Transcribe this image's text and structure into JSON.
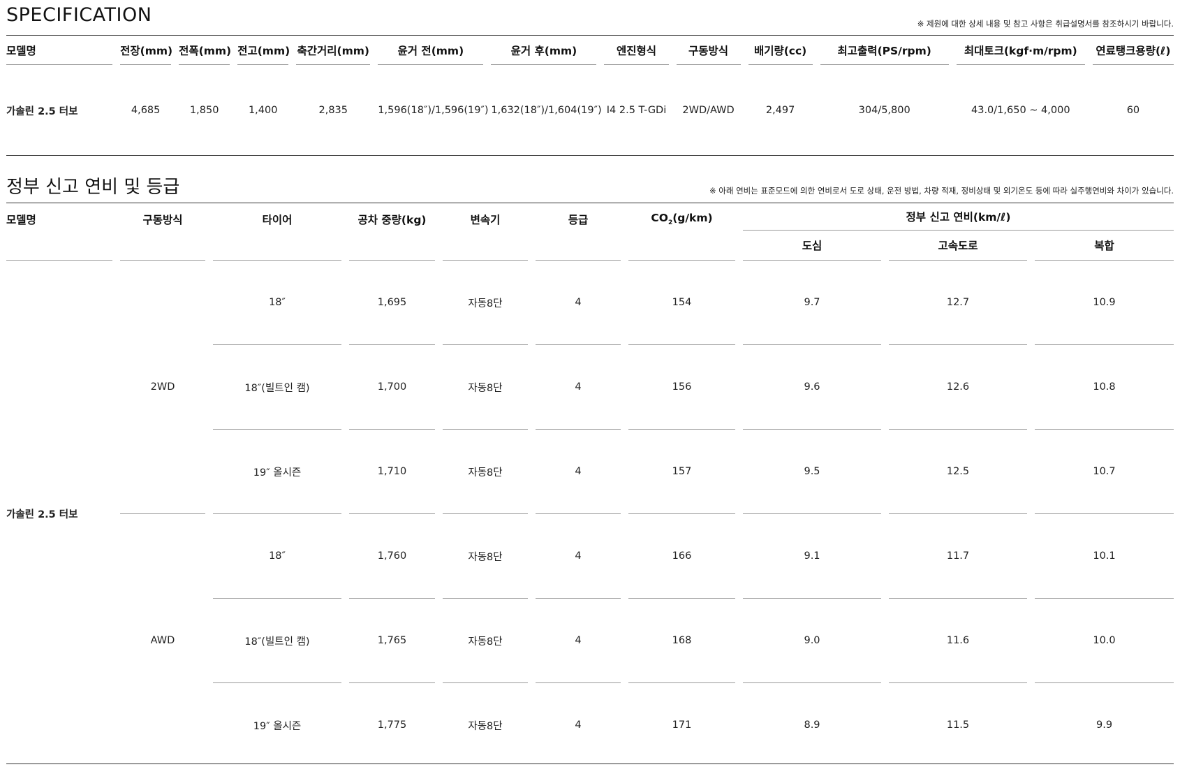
{
  "spec": {
    "title": "SPECIFICATION",
    "note": "※ 제원에 대한 상세 내용 및 참고 사항은 취급설명서를 참조하시기 바랍니다.",
    "headers": [
      "모델명",
      "전장(mm)",
      "전폭(mm)",
      "전고(mm)",
      "축간거리(mm)",
      "윤거 전(mm)",
      "윤거 후(mm)",
      "엔진형식",
      "구동방식",
      "배기량(cc)",
      "최고출력(PS/rpm)",
      "최대토크(kgf·m/rpm)",
      "연료탱크용량(ℓ)"
    ],
    "row": [
      "가솔린 2.5 터보",
      "4,685",
      "1,850",
      "1,400",
      "2,835",
      "1,596(18″)/1,596(19″)",
      "1,632(18″)/1,604(19″)",
      "I4 2.5 T-GDi",
      "2WD/AWD",
      "2,497",
      "304/5,800",
      "43.0/1,650 ~ 4,000",
      "60"
    ]
  },
  "fuel": {
    "title": "정부 신고 연비 및 등급",
    "note": "※ 아래 연비는 표준모드에 의한 연비로서 도로 상태, 운전 방법, 차량 적재, 정비상태 및 외기온도 등에 따라 실주행연비와 차이가 있습니다.",
    "headers": {
      "model": "모델명",
      "drive": "구동방식",
      "tire": "타이어",
      "weight": "공차 중량(kg)",
      "transmission": "변속기",
      "grade": "등급",
      "co2_main": "CO",
      "co2_sub": "2",
      "co2_unit": "(g/km)",
      "efficiency": "정부 신고 연비(km/ℓ)",
      "city": "도심",
      "highway": "고속도로",
      "combined": "복합"
    },
    "model": "가솔린 2.5 터보",
    "drives": [
      "2WD",
      "AWD"
    ],
    "rows": [
      {
        "tire": "18″",
        "weight": "1,695",
        "transmission": "자동8단",
        "grade": "4",
        "co2": "154",
        "city": "9.7",
        "highway": "12.7",
        "combined": "10.9"
      },
      {
        "tire": "18″(빌트인 캠)",
        "weight": "1,700",
        "transmission": "자동8단",
        "grade": "4",
        "co2": "156",
        "city": "9.6",
        "highway": "12.6",
        "combined": "10.8"
      },
      {
        "tire": "19″ 올시즌",
        "weight": "1,710",
        "transmission": "자동8단",
        "grade": "4",
        "co2": "157",
        "city": "9.5",
        "highway": "12.5",
        "combined": "10.7"
      },
      {
        "tire": "18″",
        "weight": "1,760",
        "transmission": "자동8단",
        "grade": "4",
        "co2": "166",
        "city": "9.1",
        "highway": "11.7",
        "combined": "10.1"
      },
      {
        "tire": "18″(빌트인 캠)",
        "weight": "1,765",
        "transmission": "자동8단",
        "grade": "4",
        "co2": "168",
        "city": "9.0",
        "highway": "11.6",
        "combined": "10.0"
      },
      {
        "tire": "19″ 올시즌",
        "weight": "1,775",
        "transmission": "자동8단",
        "grade": "4",
        "co2": "171",
        "city": "8.9",
        "highway": "11.5",
        "combined": "9.9"
      }
    ]
  }
}
